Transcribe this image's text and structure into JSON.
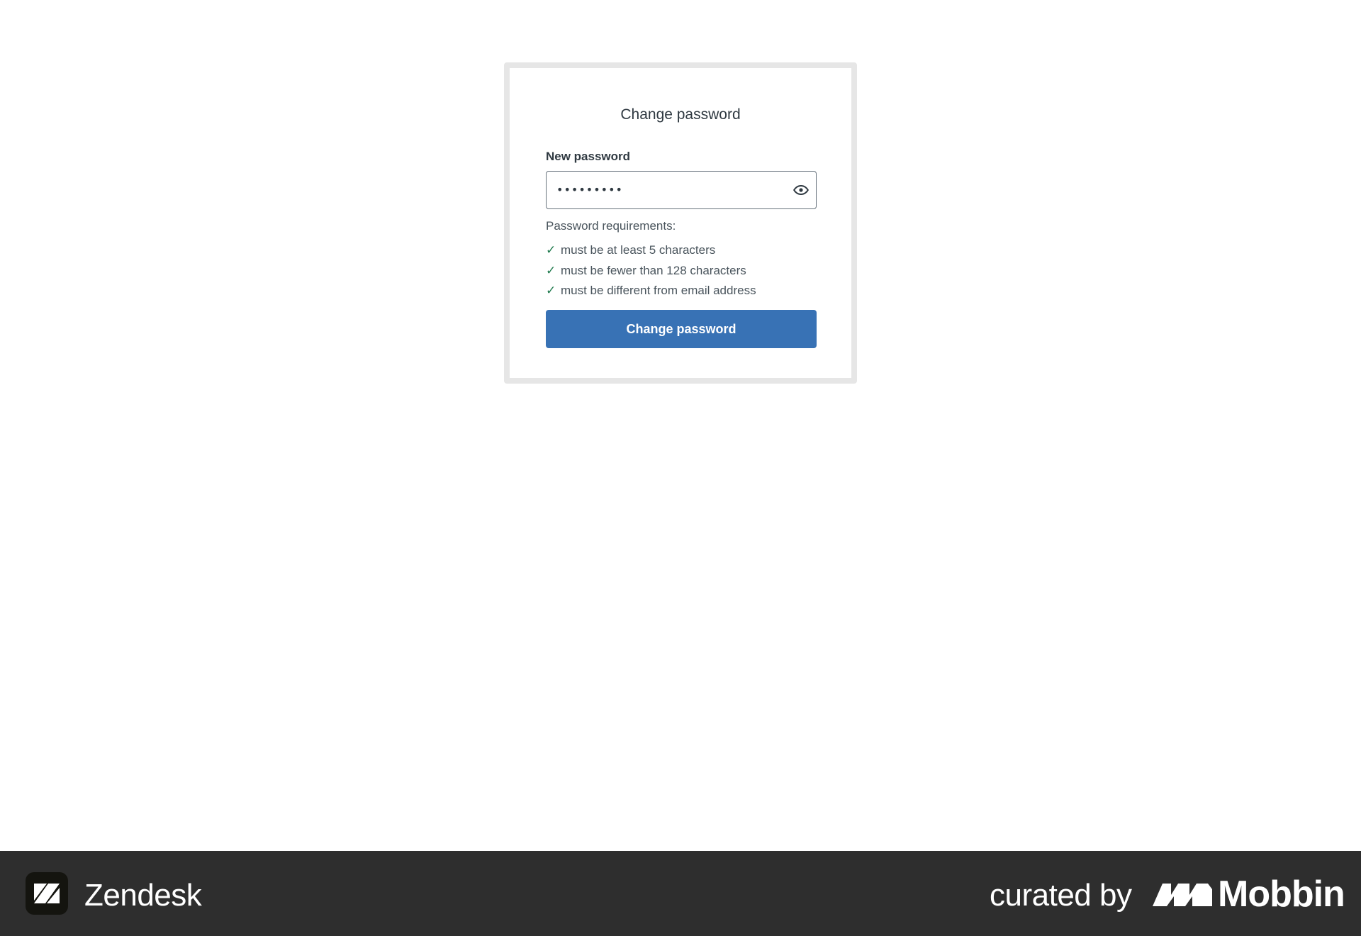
{
  "form": {
    "title": "Change password",
    "field_label": "New password",
    "password_value": "123456789",
    "requirements_title": "Password requirements:",
    "requirements": [
      "must be at least 5 characters",
      "must be fewer than 128 characters",
      "must be different from email address"
    ],
    "submit_label": "Change password"
  },
  "footer": {
    "brand": "Zendesk",
    "curated_text": "curated by",
    "curator": "Mobbin"
  },
  "colors": {
    "button": "#3872b5",
    "check": "#1f7a4d",
    "footer_bg": "#2e2e2e"
  },
  "icons": {
    "visibility": "eye-icon",
    "requirement_met": "checkmark-icon"
  }
}
